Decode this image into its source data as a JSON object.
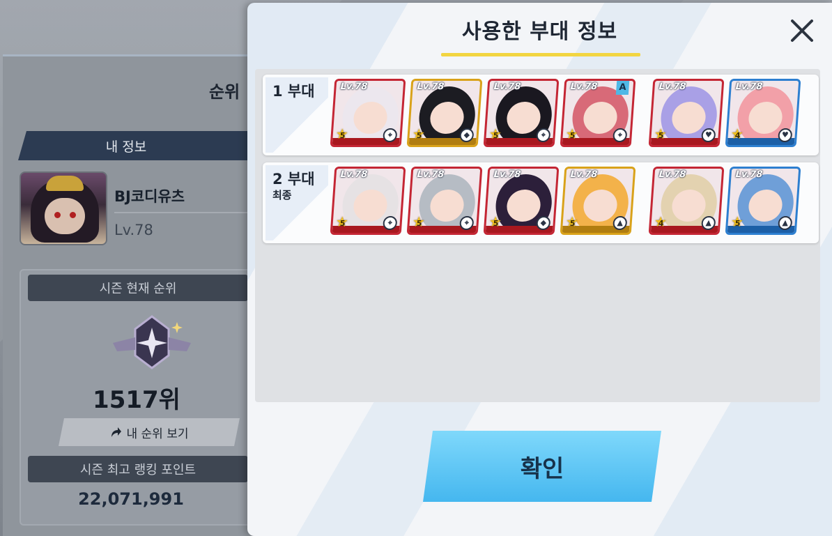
{
  "background": {
    "rank_tab_title": "순위",
    "my_info_header": "내 정보",
    "player": {
      "name": "BJ코디유츠",
      "level": "Lv.78"
    },
    "season_rank_header": "시즌 현재 순위",
    "rank_value": "1517위",
    "my_rank_button": {
      "icon": "share-arrow-icon",
      "label": "내 순위 보기"
    },
    "best_points_header": "시즌 최고 랭킹 포인트",
    "best_points_value": "22,071,991"
  },
  "modal": {
    "title": "사용한 부대 정보",
    "close_icon": "close-icon",
    "squads": [
      {
        "name": "1 부대",
        "subtitle": "",
        "members": [
          {
            "level": "Lv.78",
            "stars": "5",
            "role": "crosshair-icon",
            "frame": "red",
            "hair": "#ece7ee"
          },
          {
            "level": "Lv.78",
            "stars": "5",
            "role": "shield-icon",
            "frame": "gold",
            "hair": "#1c1c22"
          },
          {
            "level": "Lv.78",
            "stars": "5",
            "role": "crosshair-icon",
            "frame": "red",
            "hair": "#1a1820"
          },
          {
            "level": "Lv.78",
            "stars": "5",
            "role": "crosshair-icon",
            "frame": "red",
            "hair": "#d86a78",
            "badge": "A"
          },
          {
            "level": "Lv.78",
            "stars": "5",
            "role": "heal-icon",
            "frame": "red",
            "hair": "#a9a0e6"
          },
          {
            "level": "Lv.78",
            "stars": "4",
            "role": "heal-icon",
            "frame": "blue",
            "hair": "#f2a0a8"
          }
        ]
      },
      {
        "name": "2 부대",
        "subtitle": "최종",
        "members": [
          {
            "level": "Lv.78",
            "stars": "5",
            "role": "crosshair-icon",
            "frame": "red",
            "hair": "#e6e2e4"
          },
          {
            "level": "Lv.78",
            "stars": "5",
            "role": "crosshair-icon",
            "frame": "red",
            "hair": "#b6bcc4"
          },
          {
            "level": "Lv.78",
            "stars": "5",
            "role": "shield-icon",
            "frame": "red",
            "hair": "#2c1f3a"
          },
          {
            "level": "Lv.78",
            "stars": "5",
            "role": "support-icon",
            "frame": "gold",
            "hair": "#f3b24a"
          },
          {
            "level": "Lv.78",
            "stars": "4",
            "role": "support-icon",
            "frame": "red",
            "hair": "#e3d2b0"
          },
          {
            "level": "Lv.78",
            "stars": "5",
            "role": "support-icon",
            "frame": "blue",
            "hair": "#6f9fd8"
          }
        ]
      }
    ],
    "confirm_label": "확인"
  }
}
